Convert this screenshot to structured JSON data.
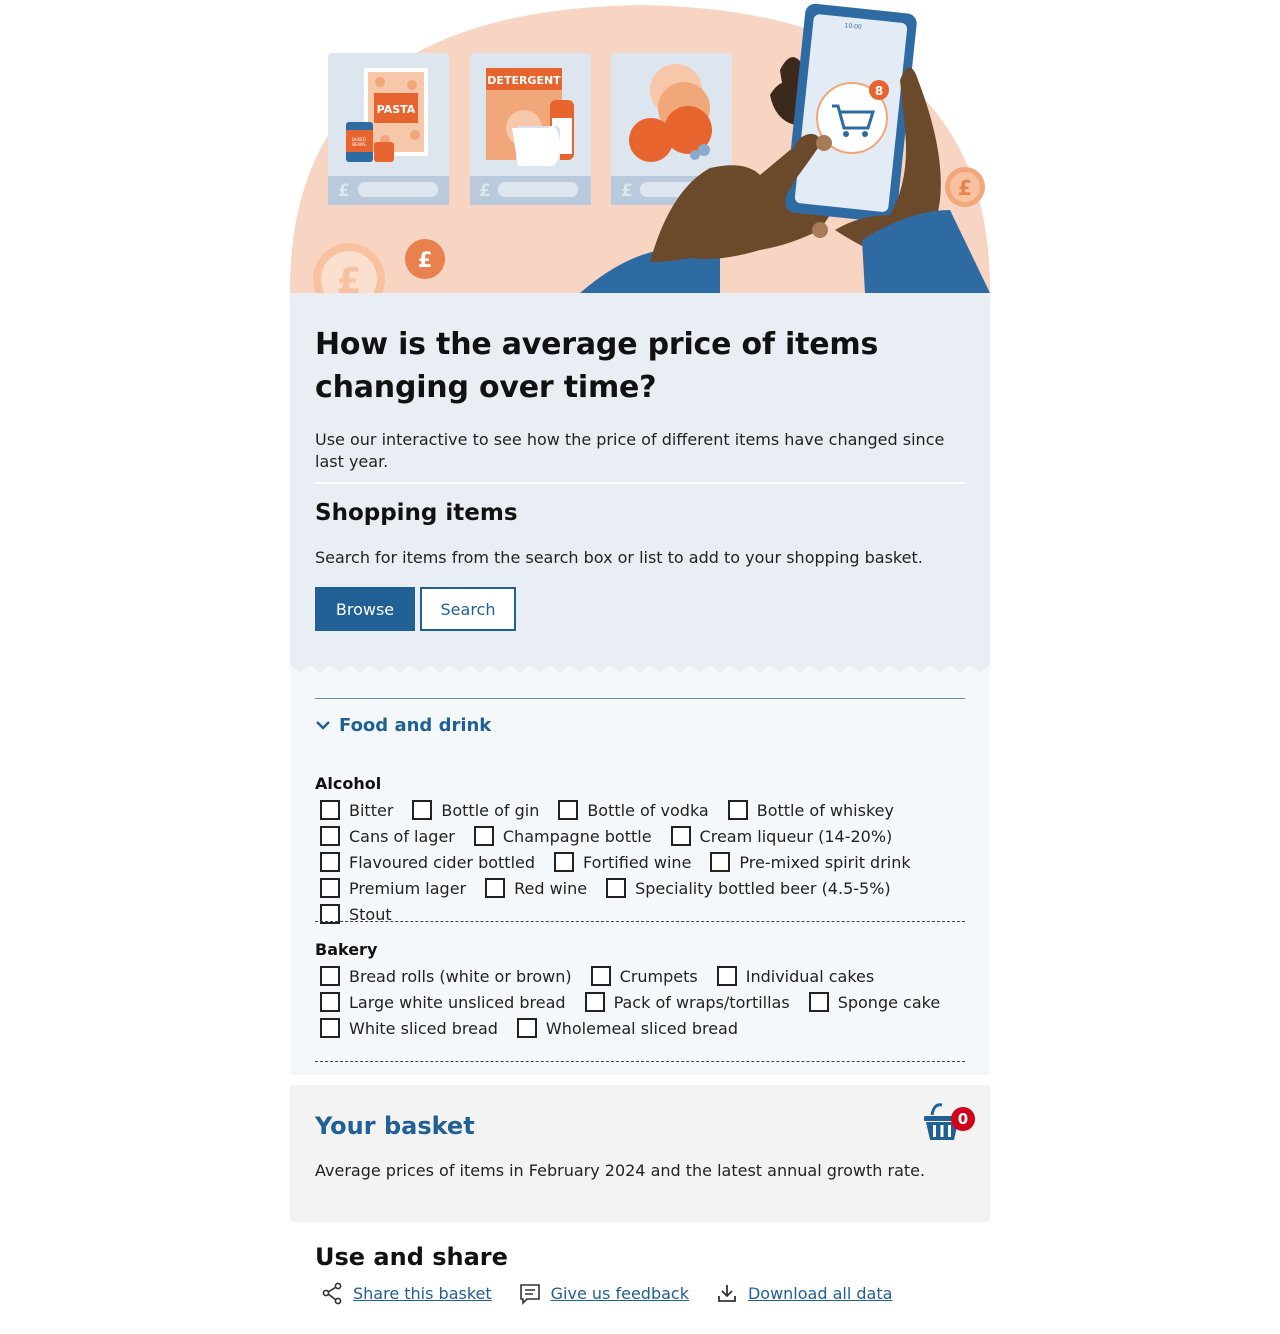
{
  "hero": {
    "labels": {
      "pasta": "PASTA",
      "beans": "BAKED BEANS",
      "detergent": "DETERGENT",
      "pound": "£",
      "phone_time": "10:00",
      "cart_count": "8"
    }
  },
  "intro": {
    "title": "How is the average price of items changing over time?",
    "lede": "Use our interactive to see how the price of different items have changed since last year."
  },
  "shopping": {
    "heading": "Shopping items",
    "description": "Search for items from the search box or list to add to your shopping basket.",
    "browse_label": "Browse",
    "search_label": "Search"
  },
  "browse": {
    "section_label": "Food and drink",
    "groups": [
      {
        "title": "Alcohol",
        "items": [
          "Bitter",
          "Bottle of gin",
          "Bottle of vodka",
          "Bottle of whiskey",
          "Cans of lager",
          "Champagne bottle",
          "Cream liqueur (14-20%)",
          "Flavoured cider bottled",
          "Fortified wine",
          "Pre-mixed spirit drink",
          "Premium lager",
          "Red wine",
          "Speciality bottled beer (4.5-5%)",
          "Stout"
        ]
      },
      {
        "title": "Bakery",
        "items": [
          "Bread rolls (white or brown)",
          "Crumpets",
          "Individual cakes",
          "Large white unsliced bread",
          "Pack of wraps/tortillas",
          "Sponge cake",
          "White sliced bread",
          "Wholemeal sliced bread"
        ]
      }
    ]
  },
  "basket": {
    "title": "Your basket",
    "count": "0",
    "description": "Average prices of items in February 2024 and the latest annual growth rate."
  },
  "share": {
    "title": "Use and share",
    "links": [
      {
        "label": "Share this basket",
        "icon": "share-icon"
      },
      {
        "label": "Give us feedback",
        "icon": "feedback-icon"
      },
      {
        "label": "Download all data",
        "icon": "download-icon"
      }
    ]
  },
  "colors": {
    "primary": "#206095",
    "panel": "#e9eef4",
    "hero_peach": "#f8d5c2",
    "accent_orange": "#e8642f",
    "badge_red": "#d0021b"
  }
}
